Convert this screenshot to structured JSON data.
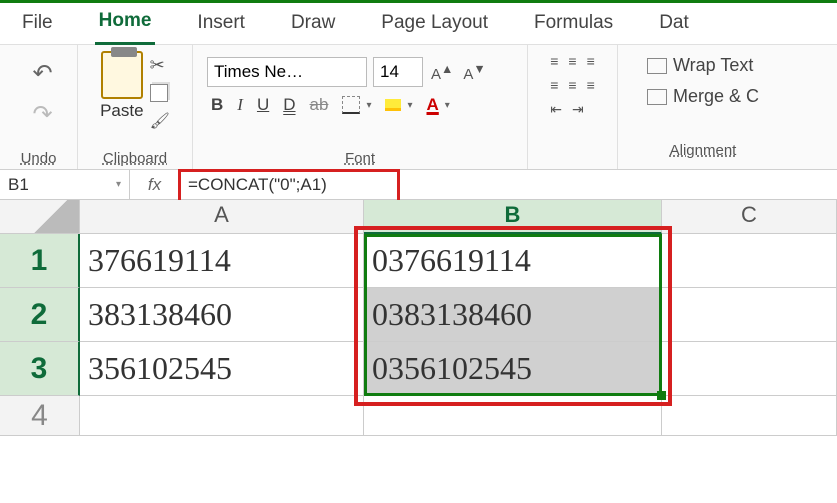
{
  "ribbon_tabs": [
    "File",
    "Home",
    "Insert",
    "Draw",
    "Page Layout",
    "Formulas",
    "Dat"
  ],
  "active_tab_index": 1,
  "groups": {
    "undo": "Undo",
    "clipboard": "Clipboard",
    "paste": "Paste",
    "font": "Font",
    "alignment": "Alignment"
  },
  "font": {
    "name": "Times Ne…",
    "size": "14",
    "buttons": {
      "b": "B",
      "i": "I",
      "u": "U",
      "du": "D",
      "strike": "ab",
      "color": "A"
    }
  },
  "wrap": {
    "wrap_text": "Wrap Text",
    "merge": "Merge & C"
  },
  "namebox": "B1",
  "fx_label": "fx",
  "formula": "=CONCAT(\"0\";A1)",
  "columns": [
    "A",
    "B",
    "C"
  ],
  "rows": [
    {
      "n": "1",
      "a": "376619114",
      "b": "0376619114"
    },
    {
      "n": "2",
      "a": "383138460",
      "b": "0383138460"
    },
    {
      "n": "3",
      "a": "356102545",
      "b": "0356102545"
    },
    {
      "n": "4",
      "a": "",
      "b": ""
    }
  ],
  "chart_data": {
    "type": "table",
    "columns": [
      "A",
      "B"
    ],
    "rows": [
      [
        "376619114",
        "0376619114"
      ],
      [
        "383138460",
        "0383138460"
      ],
      [
        "356102545",
        "0356102545"
      ]
    ],
    "formula_B": "=CONCAT(\"0\";A1)"
  }
}
